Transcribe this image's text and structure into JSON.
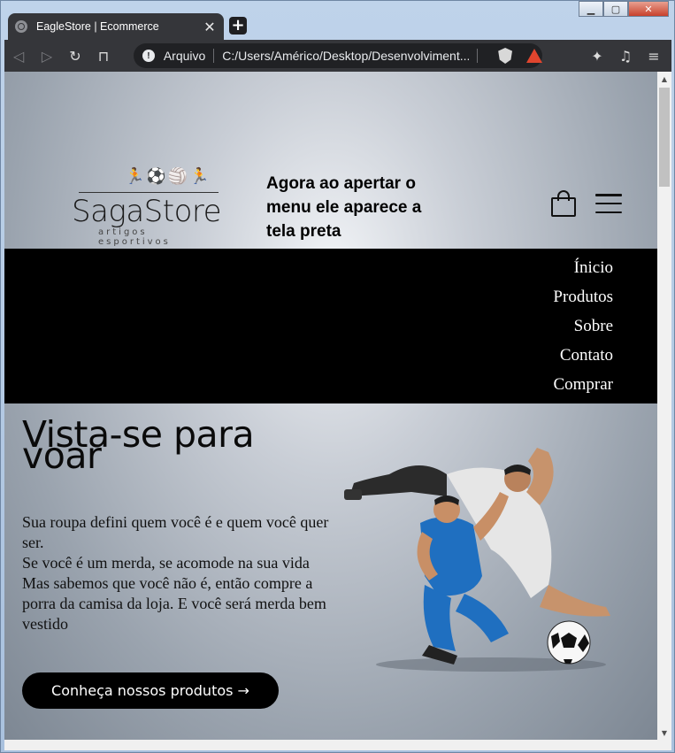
{
  "browser": {
    "tab_title": "EagleStore | Ecommerce",
    "tab_close": "✕",
    "new_tab": "+",
    "security_label": "Arquivo",
    "url": "C:/Users/Américo/Desktop/Desenvolviment...",
    "window_controls": {
      "minimize": "▁",
      "maximize": "▢",
      "close": "✕"
    }
  },
  "header": {
    "logo_name": "SagaStore",
    "logo_tagline": "artigos esportivos",
    "note": "Agora ao apertar o menu ele aparece a tela preta"
  },
  "menu": {
    "items": [
      "Ínicio",
      "Produtos",
      "Sobre",
      "Contato",
      "Comprar"
    ]
  },
  "hero": {
    "title_line1": "Vista-se para",
    "title_line2": "voar",
    "lines": [
      "Sua roupa defini quem você é e quem você quer ser.",
      "Se você é um merda, se acomode na sua vida",
      "Mas sabemos que você não é, então compre a porra da camisa da loja. E você será merda bem vestido"
    ],
    "cta": "Conheça nossos produtos →"
  }
}
